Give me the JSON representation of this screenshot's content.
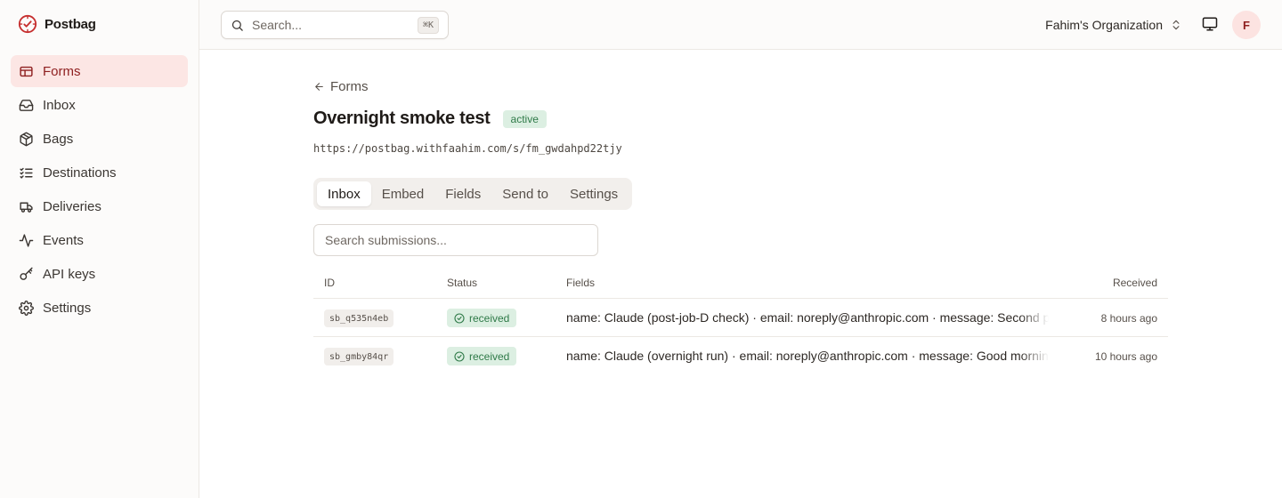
{
  "app": {
    "name": "Postbag",
    "brand_color": "#c62f2f"
  },
  "sidebar": {
    "items": [
      {
        "label": "Forms",
        "icon": "forms-icon",
        "active": true
      },
      {
        "label": "Inbox",
        "icon": "inbox-icon",
        "active": false
      },
      {
        "label": "Bags",
        "icon": "package-icon",
        "active": false
      },
      {
        "label": "Destinations",
        "icon": "list-checks-icon",
        "active": false
      },
      {
        "label": "Deliveries",
        "icon": "truck-icon",
        "active": false
      },
      {
        "label": "Events",
        "icon": "activity-icon",
        "active": false
      },
      {
        "label": "API keys",
        "icon": "key-icon",
        "active": false
      },
      {
        "label": "Settings",
        "icon": "gear-icon",
        "active": false
      }
    ]
  },
  "topbar": {
    "search_placeholder": "Search...",
    "shortcut": "⌘K",
    "organization": "Fahim's Organization",
    "avatar_initial": "F"
  },
  "page": {
    "back_label": "Forms",
    "title": "Overnight smoke test",
    "status": "active",
    "url": "https://postbag.withfaahim.com/s/fm_gwdahpd22tjy",
    "tabs": [
      {
        "label": "Inbox",
        "active": true
      },
      {
        "label": "Embed",
        "active": false
      },
      {
        "label": "Fields",
        "active": false
      },
      {
        "label": "Send to",
        "active": false
      },
      {
        "label": "Settings",
        "active": false
      }
    ],
    "submission_search_placeholder": "Search submissions..."
  },
  "table": {
    "headers": {
      "id": "ID",
      "status": "Status",
      "fields": "Fields",
      "received": "Received"
    },
    "rows": [
      {
        "id": "sb_q535n4eb",
        "status": "received",
        "fields": "name: Claude (post-job-D check) · email: noreply@anthropic.com · message: Second pass",
        "received": "8 hours ago"
      },
      {
        "id": "sb_gmby84qr",
        "status": "received",
        "fields": "name: Claude (overnight run) · email: noreply@anthropic.com · message: Good morning",
        "received": "10 hours ago"
      }
    ]
  }
}
